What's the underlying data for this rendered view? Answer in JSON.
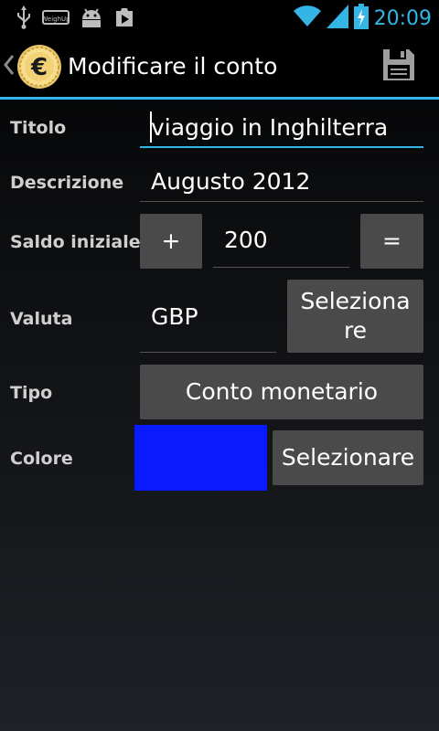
{
  "status_bar": {
    "time": "20:09",
    "icons": [
      "usb-icon",
      "weight-logo-icon",
      "android-icon",
      "play-store-icon",
      "wifi-icon",
      "signal-icon",
      "battery-charging-icon"
    ],
    "mini_label": "WeighUp"
  },
  "action_bar": {
    "title": "Modificare il conto",
    "icons": [
      "up-caret-icon",
      "euro-coin-icon",
      "save-icon"
    ]
  },
  "form": {
    "titolo": {
      "label": "Titolo",
      "value": "viaggio in Inghilterra"
    },
    "descrizione": {
      "label": "Descrizione",
      "value": "Augusto 2012"
    },
    "saldo": {
      "label": "Saldo iniziale",
      "sign": "+",
      "value": "200",
      "equals": "="
    },
    "valuta": {
      "label": "Valuta",
      "value": "GBP",
      "button_line1": "Seleziona",
      "button_line2": "re"
    },
    "tipo": {
      "label": "Tipo",
      "button": "Conto monetario"
    },
    "colore": {
      "label": "Colore",
      "swatch_color": "#0a1aff",
      "button": "Selezionare"
    }
  },
  "colors": {
    "accent": "#33b5e5",
    "button_bg": "#4a4a4a"
  }
}
